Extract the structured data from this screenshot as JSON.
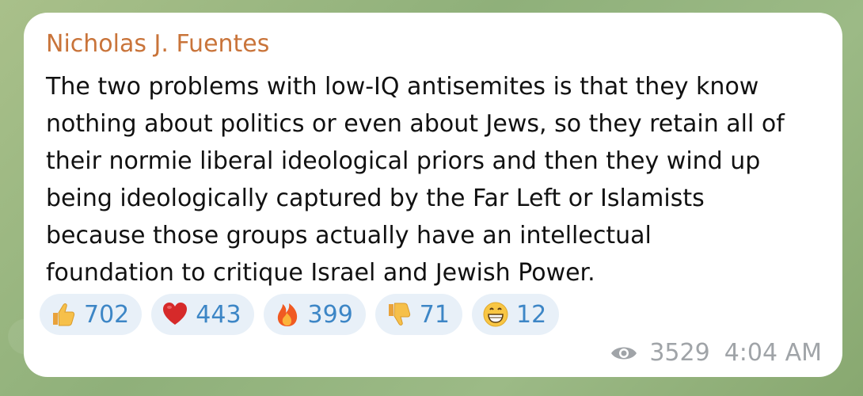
{
  "message": {
    "author": "Nicholas J. Fuentes",
    "text": "The two problems with low-IQ antisemites is that they know\nnothing about politics or even about Jews, so they retain all of\ntheir normie liberal ideological priors and then they wind up\nbeing ideologically captured by the Far Left or Islamists\nbecause those groups actually have an intellectual\nfoundation to critique Israel and Jewish Power.",
    "reactions": [
      {
        "emoji": "thumbs-up-icon",
        "count": "702"
      },
      {
        "emoji": "red-heart-icon",
        "count": "443"
      },
      {
        "emoji": "fire-icon",
        "count": "399"
      },
      {
        "emoji": "thumbs-down-icon",
        "count": "71"
      },
      {
        "emoji": "grinning-face-icon",
        "count": "12"
      }
    ],
    "views": "3529",
    "time": "4:04 AM"
  },
  "colors": {
    "author": "#c9743a",
    "reaction_count": "#3d86c6",
    "meta": "#a0a4a8",
    "reaction_bg": "#e8f0f8"
  }
}
